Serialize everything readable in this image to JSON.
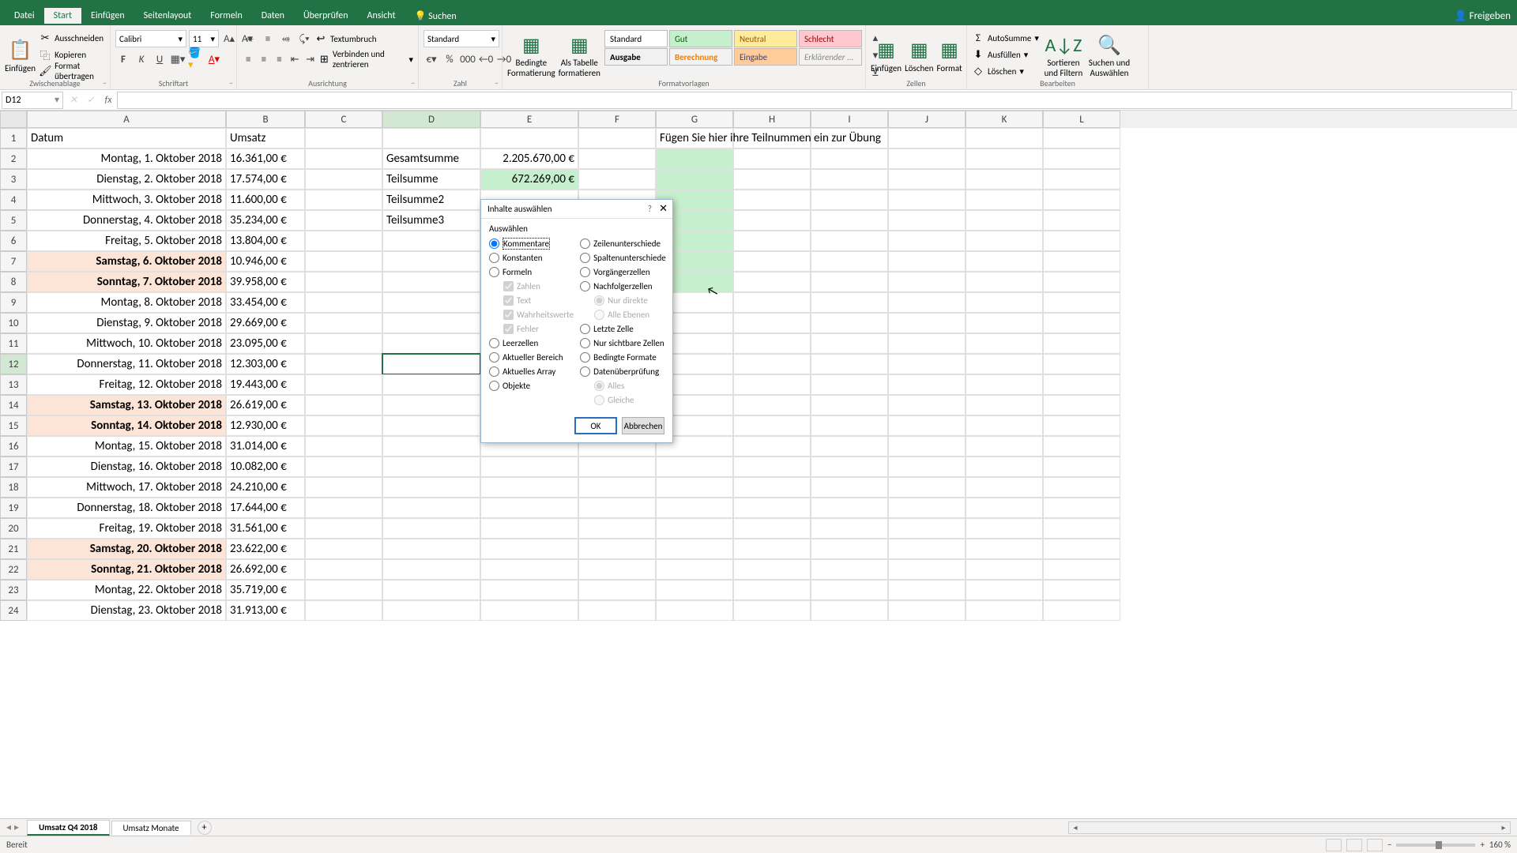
{
  "tabs": {
    "datei": "Datei",
    "start": "Start",
    "einfuegen": "Einfügen",
    "seitenlayout": "Seitenlayout",
    "formeln": "Formeln",
    "daten": "Daten",
    "ueberpruefen": "Überprüfen",
    "ansicht": "Ansicht",
    "suchen": "Suchen",
    "freigeben": "Freigeben"
  },
  "ribbon": {
    "einfuegen_btn": "Einfügen",
    "ausschneiden": "Ausschneiden",
    "kopieren": "Kopieren",
    "format_uebertragen": "Format übertragen",
    "zwischenablage": "Zwischenablage",
    "schriftart": "Schriftart",
    "font_name": "Calibri",
    "font_size": "11",
    "ausrichtung": "Ausrichtung",
    "textumbruch": "Textumbruch",
    "verbinden": "Verbinden und zentrieren",
    "zahl": "Zahl",
    "zahl_format": "Standard",
    "bedingte": "Bedingte Formatierung",
    "als_tabelle": "Als Tabelle formatieren",
    "formatvorlagen": "Formatvorlagen",
    "style_standard": "Standard",
    "style_gut": "Gut",
    "style_neutral": "Neutral",
    "style_schlecht": "Schlecht",
    "style_ausgabe": "Ausgabe",
    "style_berechnung": "Berechnung",
    "style_eingabe": "Eingabe",
    "style_erklar": "Erklärender ...",
    "zellen": "Zellen",
    "zellen_einfuegen": "Einfügen",
    "zellen_loeschen": "Löschen",
    "zellen_format": "Format",
    "bearbeiten": "Bearbeiten",
    "autosumme": "AutoSumme",
    "ausfuellen": "Ausfüllen",
    "loeschen": "Löschen",
    "sortieren": "Sortieren und Filtern",
    "suchen_auswaehlen": "Suchen und Auswählen"
  },
  "name_box": "D12",
  "columns": [
    "A",
    "B",
    "C",
    "D",
    "E",
    "F",
    "G",
    "H",
    "I",
    "J",
    "K",
    "L"
  ],
  "header_row": {
    "A": "Datum",
    "B": "Umsatz",
    "G": "Fügen Sie hier ihre Teilnummen ein zur Übung"
  },
  "labels": {
    "gesamtsumme": "Gesamtsumme",
    "teilsumme": "Teilsumme",
    "teilsumme2": "Teilsumme2",
    "teilsumme3": "Teilsumme3"
  },
  "sums": {
    "gesamt": "2.205.670,00 €",
    "teil": "672.269,00 €"
  },
  "rows": [
    {
      "n": 1
    },
    {
      "n": 2,
      "date": "Montag, 1. Oktober 2018",
      "val": "16.361,00 €"
    },
    {
      "n": 3,
      "date": "Dienstag, 2. Oktober 2018",
      "val": "17.574,00 €"
    },
    {
      "n": 4,
      "date": "Mittwoch, 3. Oktober 2018",
      "val": "11.600,00 €"
    },
    {
      "n": 5,
      "date": "Donnerstag, 4. Oktober 2018",
      "val": "35.234,00 €"
    },
    {
      "n": 6,
      "date": "Freitag, 5. Oktober 2018",
      "val": "13.804,00 €"
    },
    {
      "n": 7,
      "date": "Samstag, 6. Oktober 2018",
      "val": "10.946,00 €",
      "w": true
    },
    {
      "n": 8,
      "date": "Sonntag, 7. Oktober 2018",
      "val": "39.958,00 €",
      "w": true
    },
    {
      "n": 9,
      "date": "Montag, 8. Oktober 2018",
      "val": "33.454,00 €"
    },
    {
      "n": 10,
      "date": "Dienstag, 9. Oktober 2018",
      "val": "29.669,00 €"
    },
    {
      "n": 11,
      "date": "Mittwoch, 10. Oktober 2018",
      "val": "23.095,00 €"
    },
    {
      "n": 12,
      "date": "Donnerstag, 11. Oktober 2018",
      "val": "12.303,00 €"
    },
    {
      "n": 13,
      "date": "Freitag, 12. Oktober 2018",
      "val": "19.443,00 €"
    },
    {
      "n": 14,
      "date": "Samstag, 13. Oktober 2018",
      "val": "26.619,00 €",
      "w": true
    },
    {
      "n": 15,
      "date": "Sonntag, 14. Oktober 2018",
      "val": "12.930,00 €",
      "w": true
    },
    {
      "n": 16,
      "date": "Montag, 15. Oktober 2018",
      "val": "31.014,00 €"
    },
    {
      "n": 17,
      "date": "Dienstag, 16. Oktober 2018",
      "val": "10.082,00 €"
    },
    {
      "n": 18,
      "date": "Mittwoch, 17. Oktober 2018",
      "val": "24.210,00 €"
    },
    {
      "n": 19,
      "date": "Donnerstag, 18. Oktober 2018",
      "val": "17.644,00 €"
    },
    {
      "n": 20,
      "date": "Freitag, 19. Oktober 2018",
      "val": "31.561,00 €"
    },
    {
      "n": 21,
      "date": "Samstag, 20. Oktober 2018",
      "val": "23.622,00 €",
      "w": true
    },
    {
      "n": 22,
      "date": "Sonntag, 21. Oktober 2018",
      "val": "26.692,00 €",
      "w": true
    },
    {
      "n": 23,
      "date": "Montag, 22. Oktober 2018",
      "val": "35.719,00 €"
    },
    {
      "n": 24,
      "date": "Dienstag, 23. Oktober 2018",
      "val": "31.913,00 €"
    }
  ],
  "dialog": {
    "title": "Inhalte auswählen",
    "auswaehlen": "Auswählen",
    "kommentare": "Kommentare",
    "konstanten": "Konstanten",
    "formeln": "Formeln",
    "zahlen": "Zahlen",
    "text": "Text",
    "wahrheitswerte": "Wahrheitswerte",
    "fehler": "Fehler",
    "leerzellen": "Leerzellen",
    "aktueller_bereich": "Aktueller Bereich",
    "aktuelles_array": "Aktuelles Array",
    "objekte": "Objekte",
    "zeilenunterschiede": "Zeilenunterschiede",
    "spaltenunterschiede": "Spaltenunterschiede",
    "vorgaengerzellen": "Vorgängerzellen",
    "nachfolgerzellen": "Nachfolgerzellen",
    "nur_direkte": "Nur direkte",
    "alle_ebenen": "Alle Ebenen",
    "letzte_zelle": "Letzte Zelle",
    "nur_sichtbare": "Nur sichtbare Zellen",
    "bedingte_formate": "Bedingte Formate",
    "datenueberpruefung": "Datenüberprüfung",
    "alles": "Alles",
    "gleiche": "Gleiche",
    "ok": "OK",
    "abbrechen": "Abbrechen"
  },
  "sheets": {
    "tab1": "Umsatz Q4 2018",
    "tab2": "Umsatz Monate"
  },
  "status": {
    "bereit": "Bereit",
    "zoom": "160 %"
  }
}
